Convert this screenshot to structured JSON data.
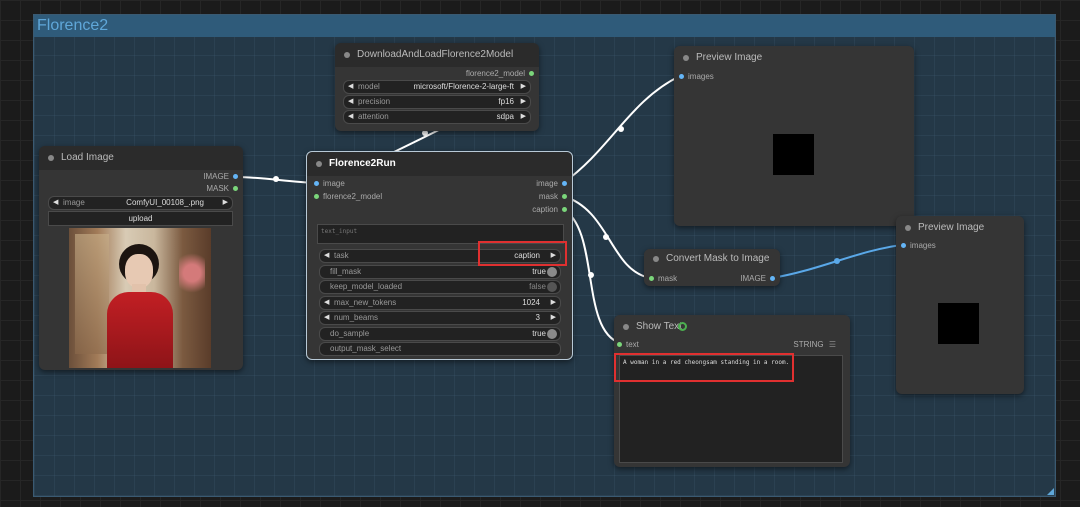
{
  "group": {
    "title": "Florence2"
  },
  "download_node": {
    "title": "DownloadAndLoadFlorence2Model",
    "output": "florence2_model",
    "widgets": [
      {
        "label": "model",
        "value": "microsoft/Florence-2-large-ft"
      },
      {
        "label": "precision",
        "value": "fp16"
      },
      {
        "label": "attention",
        "value": "sdpa"
      }
    ]
  },
  "load_image_node": {
    "title": "Load Image",
    "outputs": [
      "IMAGE",
      "MASK"
    ],
    "image_widget": {
      "label": "image",
      "value": "ComfyUI_00108_.png"
    },
    "upload_label": "upload"
  },
  "florence_run_node": {
    "title": "Florence2Run",
    "inputs": [
      "image",
      "florence2_model"
    ],
    "outputs": [
      "image",
      "mask",
      "caption"
    ],
    "text_input_placeholder": "text_input",
    "widgets": [
      {
        "label": "task",
        "value": "caption",
        "kind": "combo"
      },
      {
        "label": "fill_mask",
        "value": "true",
        "kind": "toggle",
        "on": true
      },
      {
        "label": "keep_model_loaded",
        "value": "false",
        "kind": "toggle",
        "on": false
      },
      {
        "label": "max_new_tokens",
        "value": "1024",
        "kind": "number"
      },
      {
        "label": "num_beams",
        "value": "3",
        "kind": "number"
      },
      {
        "label": "do_sample",
        "value": "true",
        "kind": "toggle",
        "on": true
      },
      {
        "label": "output_mask_select",
        "value": "",
        "kind": "text"
      }
    ]
  },
  "preview_top": {
    "title": "Preview Image",
    "input": "images"
  },
  "convert_mask_node": {
    "title": "Convert Mask to Image",
    "input": "mask",
    "output": "IMAGE"
  },
  "preview_right": {
    "title": "Preview Image",
    "input": "images"
  },
  "show_text_node": {
    "title": "Show Text",
    "title_icon": "python-snake-icon",
    "input": "text",
    "output": "STRING",
    "output_icon": "list-icon",
    "content": "A woman in a red cheongsam standing in a room."
  },
  "colors": {
    "image_link": "#ffffff",
    "mask_link": "#5aa8e8",
    "highlight": "#e03030"
  }
}
